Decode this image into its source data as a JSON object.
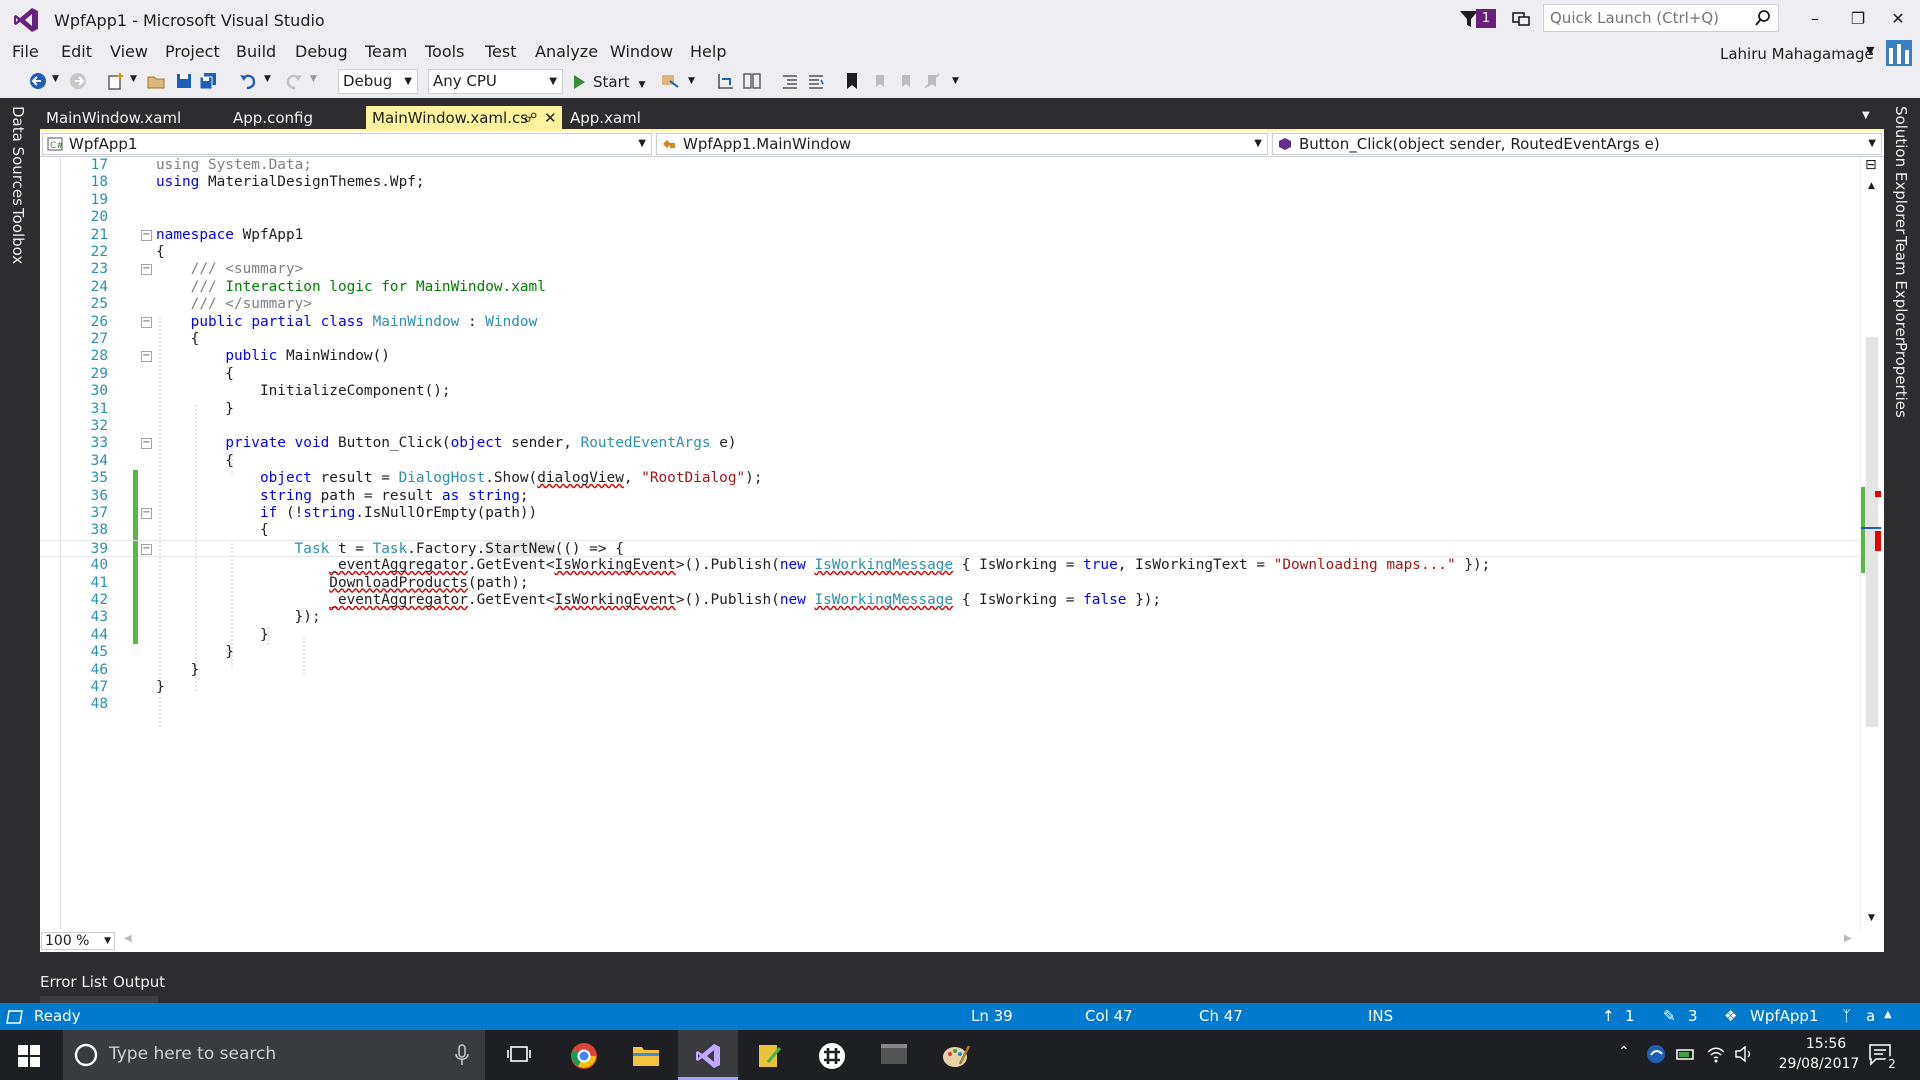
{
  "window": {
    "title": "WpfApp1 - Microsoft Visual Studio",
    "notification_count": "1",
    "quick_launch_placeholder": "Quick Launch (Ctrl+Q)",
    "user": "Lahiru Mahagamage"
  },
  "menu": [
    "File",
    "Edit",
    "View",
    "Project",
    "Build",
    "Debug",
    "Team",
    "Tools",
    "Test",
    "Analyze",
    "Window",
    "Help"
  ],
  "toolbar": {
    "config": "Debug",
    "platform": "Any CPU",
    "start_label": "Start"
  },
  "left_rail": [
    "Data Sources",
    "Toolbox"
  ],
  "right_rail": [
    "Solution Explorer",
    "Team Explorer",
    "Properties"
  ],
  "tabs": [
    {
      "label": "MainWindow.xaml"
    },
    {
      "label": "App.config"
    },
    {
      "label": "MainWindow.xaml.cs"
    },
    {
      "label": "App.xaml"
    }
  ],
  "navbar": {
    "project": "WpfApp1",
    "type": "WpfApp1.MainWindow",
    "member": "Button_Click(object sender, RoutedEventArgs e)"
  },
  "code": {
    "lines": [
      {
        "n": "17",
        "text": "using System.Data;"
      },
      {
        "n": "18",
        "text": "using MaterialDesignThemes.Wpf;"
      },
      {
        "n": "19",
        "text": ""
      },
      {
        "n": "20",
        "text": ""
      },
      {
        "n": "21",
        "text": "namespace WpfApp1"
      },
      {
        "n": "22",
        "text": "{"
      },
      {
        "n": "23",
        "text": "    /// <summary>"
      },
      {
        "n": "24",
        "text": "    /// Interaction logic for MainWindow.xaml"
      },
      {
        "n": "25",
        "text": "    /// </summary>"
      },
      {
        "n": "26",
        "text": "    public partial class MainWindow : Window"
      },
      {
        "n": "27",
        "text": "    {"
      },
      {
        "n": "28",
        "text": "        public MainWindow()"
      },
      {
        "n": "29",
        "text": "        {"
      },
      {
        "n": "30",
        "text": "            InitializeComponent();"
      },
      {
        "n": "31",
        "text": "        }"
      },
      {
        "n": "32",
        "text": ""
      },
      {
        "n": "33",
        "text": "        private void Button_Click(object sender, RoutedEventArgs e)"
      },
      {
        "n": "34",
        "text": "        {"
      },
      {
        "n": "35",
        "text": "            object result = DialogHost.Show(dialogView, \"RootDialog\");"
      },
      {
        "n": "36",
        "text": "            string path = result as string;"
      },
      {
        "n": "37",
        "text": "            if (!string.IsNullOrEmpty(path))"
      },
      {
        "n": "38",
        "text": "            {"
      },
      {
        "n": "39",
        "text": "                Task t = Task.Factory.StartNew(() => {"
      },
      {
        "n": "40",
        "text": "                    _eventAggregator.GetEvent<IsWorkingEvent>().Publish(new IsWorkingMessage { IsWorking = true, IsWorkingText = \"Downloading maps...\" });"
      },
      {
        "n": "41",
        "text": "                    DownloadProducts(path);"
      },
      {
        "n": "42",
        "text": "                    _eventAggregator.GetEvent<IsWorkingEvent>().Publish(new IsWorkingMessage { IsWorking = false });"
      },
      {
        "n": "43",
        "text": "                });"
      },
      {
        "n": "44",
        "text": "            }"
      },
      {
        "n": "45",
        "text": "        }"
      },
      {
        "n": "46",
        "text": "    }"
      },
      {
        "n": "47",
        "text": "}"
      },
      {
        "n": "48",
        "text": ""
      }
    ]
  },
  "zoom": "100 %",
  "tool_tabs": [
    "Error List",
    "Output"
  ],
  "status": {
    "ready": "Ready",
    "ln": "Ln 39",
    "col": "Col 47",
    "ch": "Ch 47",
    "ins": "INS",
    "pushes": "1",
    "changes": "3",
    "repo": "WpfApp1",
    "branch": "a"
  },
  "taskbar": {
    "search_placeholder": "Type here to search",
    "time": "15:56",
    "date": "29/08/2017",
    "notifications": "2"
  },
  "colors": {
    "accent": "#007acc",
    "chrome_dark": "#2d2d30",
    "active_tab": "#fff29d",
    "vs_purple": "#68217a",
    "change_green": "#57b846"
  }
}
